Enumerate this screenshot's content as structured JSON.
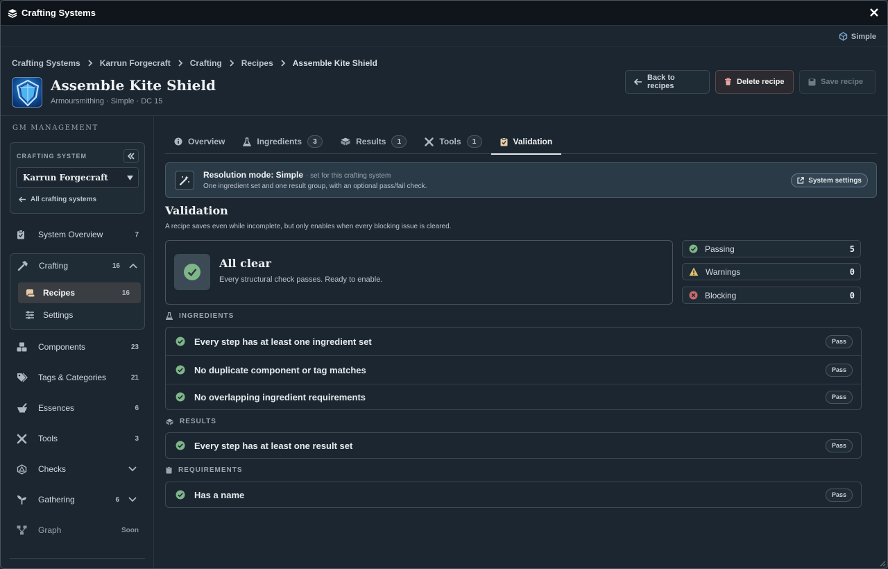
{
  "window": {
    "title": "Crafting Systems",
    "mode": "Simple"
  },
  "breadcrumbs": [
    "Crafting Systems",
    "Karrun Forgecraft",
    "Crafting",
    "Recipes",
    "Assemble Kite Shield"
  ],
  "recipe": {
    "title": "Assemble Kite Shield",
    "subtitle": "Armoursmithing · Simple · DC 15"
  },
  "actions": {
    "back": "Back to recipes",
    "delete": "Delete recipe",
    "save": "Save recipe"
  },
  "sidebar": {
    "heading": "GM MANAGEMENT",
    "crafting_system_label": "CRAFTING SYSTEM",
    "selected_system": "Karrun Forgecraft",
    "all_systems_link": "All crafting systems",
    "items": [
      {
        "label": "System Overview",
        "count": "7",
        "icon": "clipboard-icon"
      },
      {
        "label": "Crafting",
        "count": "16",
        "icon": "hammer-icon"
      },
      {
        "label": "Components",
        "count": "23",
        "icon": "boxes-icon"
      },
      {
        "label": "Tags & Categories",
        "count": "21",
        "icon": "tags-icon"
      },
      {
        "label": "Essences",
        "count": "6",
        "icon": "mortar-icon"
      },
      {
        "label": "Tools",
        "count": "3",
        "icon": "tools-icon"
      },
      {
        "label": "Checks",
        "count": "",
        "icon": "d20-icon"
      },
      {
        "label": "Gathering",
        "count": "6",
        "icon": "sprout-icon"
      },
      {
        "label": "Graph",
        "count": "Soon",
        "icon": "graph-icon"
      }
    ],
    "sub_items": [
      {
        "label": "Recipes",
        "count": "16",
        "icon": "scroll-icon"
      },
      {
        "label": "Settings",
        "count": "",
        "icon": "sliders-icon"
      }
    ]
  },
  "tabs": [
    {
      "label": "Overview",
      "badge": "",
      "icon": "info-icon"
    },
    {
      "label": "Ingredients",
      "badge": "3",
      "icon": "flask-icon"
    },
    {
      "label": "Results",
      "badge": "1",
      "icon": "box-icon"
    },
    {
      "label": "Tools",
      "badge": "1",
      "icon": "tools-icon"
    },
    {
      "label": "Validation",
      "badge": "",
      "icon": "clipboard-check-icon"
    }
  ],
  "banner": {
    "title": "Resolution mode: Simple",
    "note": "· set for this crafting system",
    "desc": "One ingredient set and one result group, with an optional pass/fail check.",
    "button": "System settings"
  },
  "validation": {
    "heading": "Validation",
    "desc": "A recipe saves even while incomplete, but only enables when every blocking issue is cleared.",
    "summary_title": "All clear",
    "summary_desc": "Every structural check passes. Ready to enable.",
    "stats": [
      {
        "label": "Passing",
        "value": "5"
      },
      {
        "label": "Warnings",
        "value": "0"
      },
      {
        "label": "Blocking",
        "value": "0"
      }
    ],
    "sections": [
      {
        "title": "INGREDIENTS",
        "checks": [
          {
            "label": "Every step has at least one ingredient set",
            "status": "Pass"
          },
          {
            "label": "No duplicate component or tag matches",
            "status": "Pass"
          },
          {
            "label": "No overlapping ingredient requirements",
            "status": "Pass"
          }
        ]
      },
      {
        "title": "RESULTS",
        "checks": [
          {
            "label": "Every step has at least one result set",
            "status": "Pass"
          }
        ]
      },
      {
        "title": "REQUIREMENTS",
        "checks": [
          {
            "label": "Has a name",
            "status": "Pass"
          }
        ]
      }
    ]
  },
  "colors": {
    "pass": "#7fb58a",
    "warning": "#e2c26a",
    "blocking": "#c86a6a",
    "accent": "#e6e9ec"
  }
}
